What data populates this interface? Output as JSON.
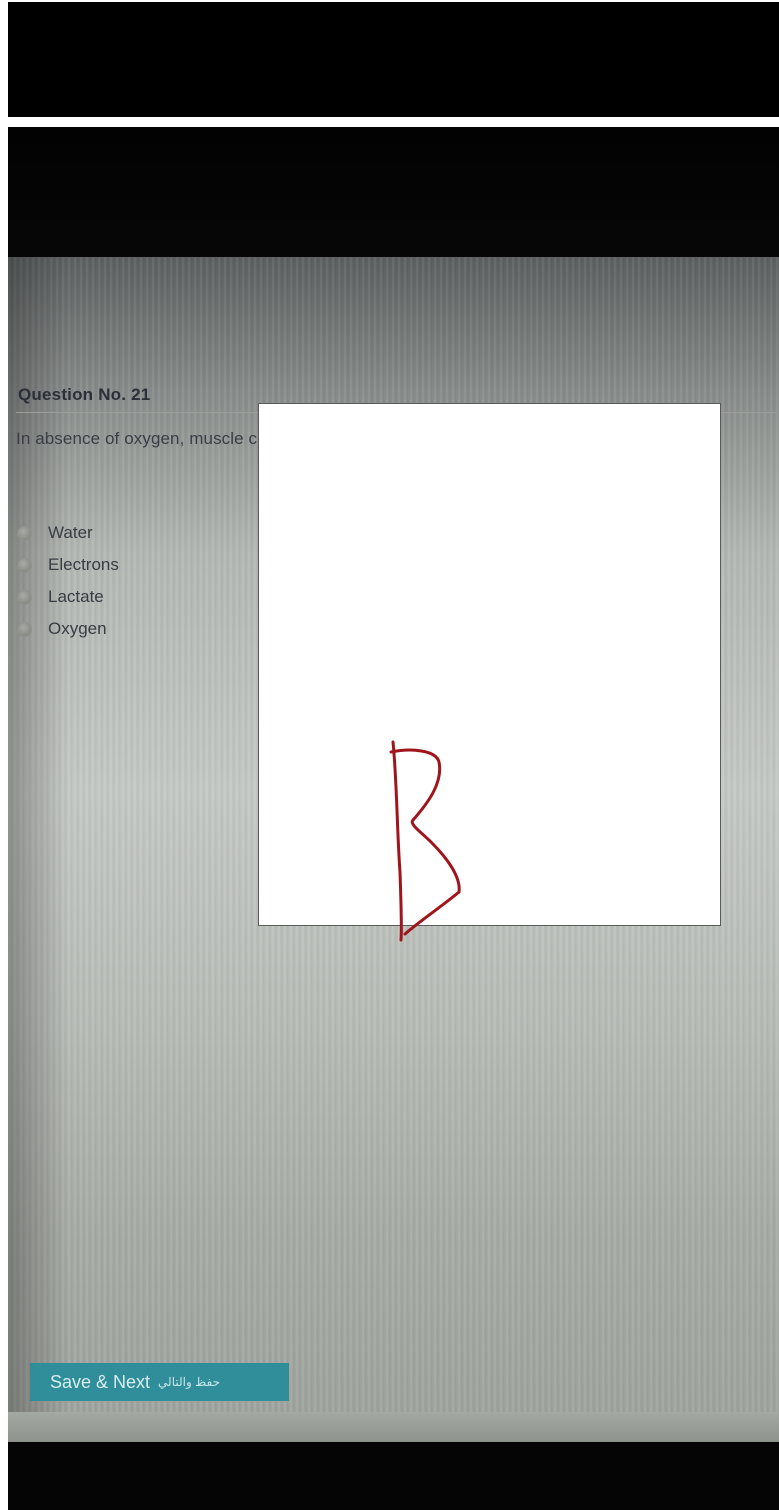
{
  "question": {
    "header": "Question No. 21",
    "text": "In absence of oxygen, muscle cells supplied with pyruvate will produce ..",
    "options": [
      {
        "label": "Water"
      },
      {
        "label": "Electrons"
      },
      {
        "label": "Lactate"
      },
      {
        "label": "Oxygen"
      }
    ]
  },
  "answer_card": {
    "handwritten_answer": "B",
    "ink_color": "#a0151c"
  },
  "footer": {
    "save_label": "Save & Next",
    "save_label_arabic": "حفظ والتالي"
  },
  "colors": {
    "button_bg": "#2f8e99",
    "background_dark": "#000000"
  }
}
